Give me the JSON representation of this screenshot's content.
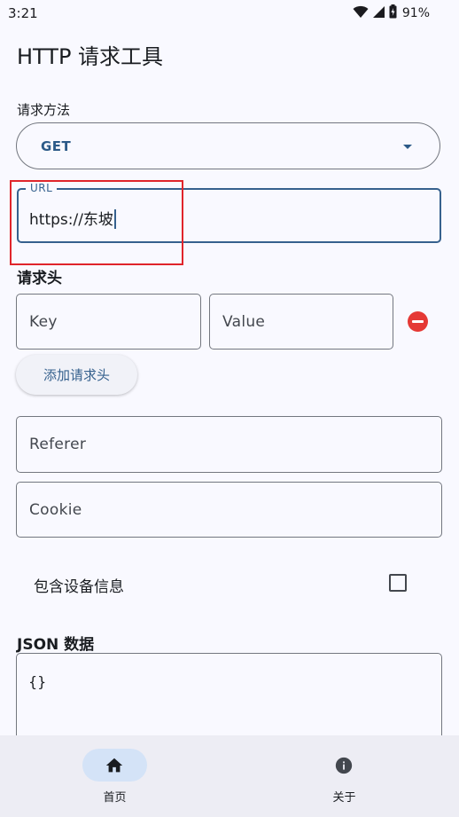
{
  "status_bar": {
    "time": "3:21",
    "battery": "91%"
  },
  "page": {
    "title": "HTTP 请求工具"
  },
  "method": {
    "label": "请求方法",
    "selected": "GET"
  },
  "url": {
    "label": "URL",
    "value": "https://东坡"
  },
  "headers": {
    "heading": "请求头",
    "key_placeholder": "Key",
    "value_placeholder": "Value",
    "add_button_label": "添加请求头"
  },
  "referer": {
    "placeholder": "Referer"
  },
  "cookie": {
    "placeholder": "Cookie"
  },
  "device_info": {
    "label": "包含设备信息",
    "checked": false
  },
  "json": {
    "heading": "JSON 数据",
    "value": "{}"
  },
  "bottom_nav": {
    "items": [
      {
        "label": "首页",
        "icon": "home-icon",
        "active": true
      },
      {
        "label": "关于",
        "icon": "info-icon",
        "active": false
      }
    ]
  },
  "colors": {
    "accent": "#36618e",
    "remove": "#e53935",
    "highlight": "#e0252b",
    "nav_indicator": "#d4e3f7",
    "nav_background": "#ededf4"
  }
}
